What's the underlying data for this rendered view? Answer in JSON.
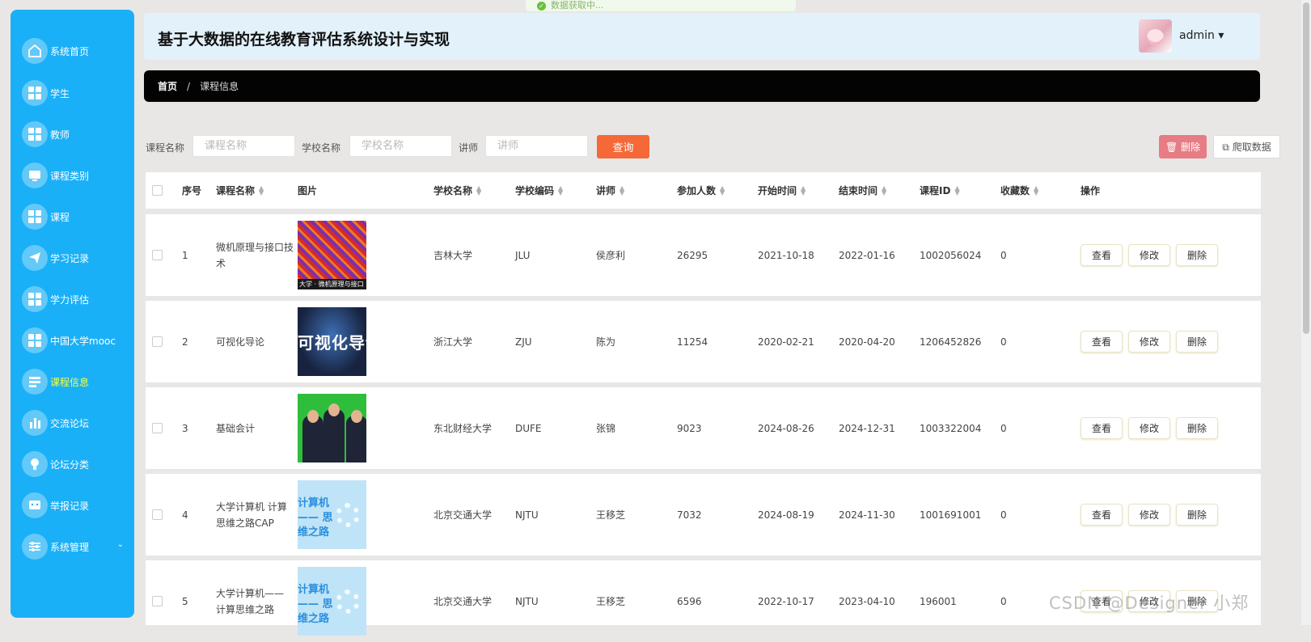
{
  "toast": {
    "text": "数据获取中..."
  },
  "header": {
    "title": "基于大数据的在线教育评估系统设计与实现",
    "username": "admin",
    "user_caret": "▾"
  },
  "sidebar": {
    "items": [
      {
        "label": "系统首页",
        "icon": "home-icon"
      },
      {
        "label": "学生",
        "icon": "grid-icon"
      },
      {
        "label": "教师",
        "icon": "grid-icon"
      },
      {
        "label": "课程类别",
        "icon": "monitor-icon"
      },
      {
        "label": "课程",
        "icon": "grid-icon"
      },
      {
        "label": "学习记录",
        "icon": "paper-plane-icon"
      },
      {
        "label": "学力评估",
        "icon": "grid-icon"
      },
      {
        "label": "中国大学mooc",
        "icon": "grid-icon"
      },
      {
        "label": "课程信息",
        "icon": "list-icon"
      },
      {
        "label": "交流论坛",
        "icon": "bar-chart-icon"
      },
      {
        "label": "论坛分类",
        "icon": "bulb-icon"
      },
      {
        "label": "举报记录",
        "icon": "chat-icon"
      },
      {
        "label": "系统管理",
        "icon": "sliders-icon",
        "arrow": "⌄"
      }
    ],
    "active_index": 8
  },
  "breadcrumb": {
    "home": "首页",
    "sep": "/",
    "current": "课程信息"
  },
  "search": {
    "course_label": "课程名称",
    "course_placeholder": "课程名称",
    "school_label": "学校名称",
    "school_placeholder": "学校名称",
    "teacher_label": "讲师",
    "teacher_placeholder": "讲师",
    "query_label": "查询",
    "delete_label": "删除",
    "report_label": "爬取数据"
  },
  "table": {
    "headers": {
      "no": "序号",
      "name": "课程名称",
      "image": "图片",
      "school": "学校名称",
      "code": "学校编码",
      "teacher": "讲师",
      "participants": "参加人数",
      "start": "开始时间",
      "end": "结束时间",
      "course_id": "课程ID",
      "favorites": "收藏数",
      "actions": "操作"
    },
    "rows": [
      {
        "no": "1",
        "name": "微机原理与接口技术",
        "thumb_text": "大学 · 微机原理与接口",
        "school": "吉林大学",
        "code": "JLU",
        "teacher": "侯彦利",
        "participants": "26295",
        "start": "2021-10-18",
        "end": "2022-01-16",
        "course_id": "1002056024",
        "favorites": "0"
      },
      {
        "no": "2",
        "name": "可视化导论",
        "thumb_text": "可视化导论",
        "school": "浙江大学",
        "code": "ZJU",
        "teacher": "陈为",
        "participants": "11254",
        "start": "2020-02-21",
        "end": "2020-04-20",
        "course_id": "1206452826",
        "favorites": "0"
      },
      {
        "no": "3",
        "name": "基础会计",
        "thumb_text": "",
        "school": "东北财经大学",
        "code": "DUFE",
        "teacher": "张锦",
        "participants": "9023",
        "start": "2024-08-26",
        "end": "2024-12-31",
        "course_id": "1003322004",
        "favorites": "0"
      },
      {
        "no": "4",
        "name": "大学计算机 计算思维之路CAP",
        "thumb_text": "计算机—— 思维之路",
        "school": "北京交通大学",
        "code": "NJTU",
        "teacher": "王移芝",
        "participants": "7032",
        "start": "2024-08-19",
        "end": "2024-11-30",
        "course_id": "1001691001",
        "favorites": "0"
      },
      {
        "no": "5",
        "name": "大学计算机—— 计算思维之路",
        "thumb_text": "计算机—— 思维之路",
        "school": "北京交通大学",
        "code": "NJTU",
        "teacher": "王移芝",
        "participants": "6596",
        "start": "2022-10-17",
        "end": "2023-04-10",
        "course_id": "196001",
        "favorites": "0"
      }
    ],
    "action_labels": {
      "view": "查看",
      "edit": "修改",
      "delete": "删除"
    }
  },
  "watermark": "CSDN @Designer 小郑"
}
